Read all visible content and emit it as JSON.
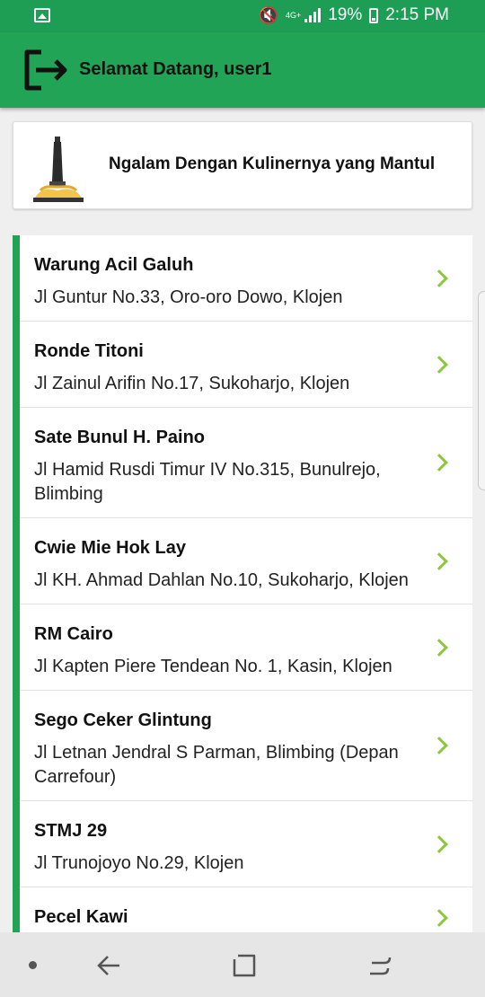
{
  "status_bar": {
    "network_type": "4G+",
    "battery": "19%",
    "time": "2:15 PM",
    "icons": [
      "image-icon",
      "mute-icon",
      "signal-icon",
      "battery-icon"
    ]
  },
  "app_bar": {
    "title": "Selamat Datang, user1",
    "icon": "logout-icon"
  },
  "banner": {
    "text": "Ngalam Dengan Kulinernya yang Mantul",
    "icon": "monument-icon"
  },
  "list": {
    "items": [
      {
        "name": "Warung Acil Galuh",
        "address": "Jl Guntur No.33, Oro-oro Dowo, Klojen"
      },
      {
        "name": "Ronde Titoni",
        "address": "Jl Zainul Arifin No.17, Sukoharjo, Klojen"
      },
      {
        "name": "Sate Bunul H. Paino",
        "address": "Jl Hamid Rusdi Timur IV No.315, Bunulrejo, Blimbing"
      },
      {
        "name": "Cwie Mie Hok Lay",
        "address": "Jl KH. Ahmad Dahlan No.10, Sukoharjo, Klojen"
      },
      {
        "name": "RM Cairo",
        "address": "Jl Kapten Piere Tendean No. 1, Kasin, Klojen"
      },
      {
        "name": "Sego Ceker Glintung",
        "address": "Jl Letnan Jendral S Parman, Blimbing (Depan Carrefour)"
      },
      {
        "name": "STMJ 29",
        "address": "Jl Trunojoyo No.29, Klojen"
      },
      {
        "name": "Pecel Kawi",
        "address": ""
      }
    ]
  },
  "colors": {
    "primary": "#21a456",
    "status_bar": "#1e9e55",
    "chevron": "#8cc63f"
  },
  "nav_bar": {
    "icons": [
      "dot-icon",
      "back-icon",
      "recents-icon",
      "switch-icon"
    ]
  }
}
